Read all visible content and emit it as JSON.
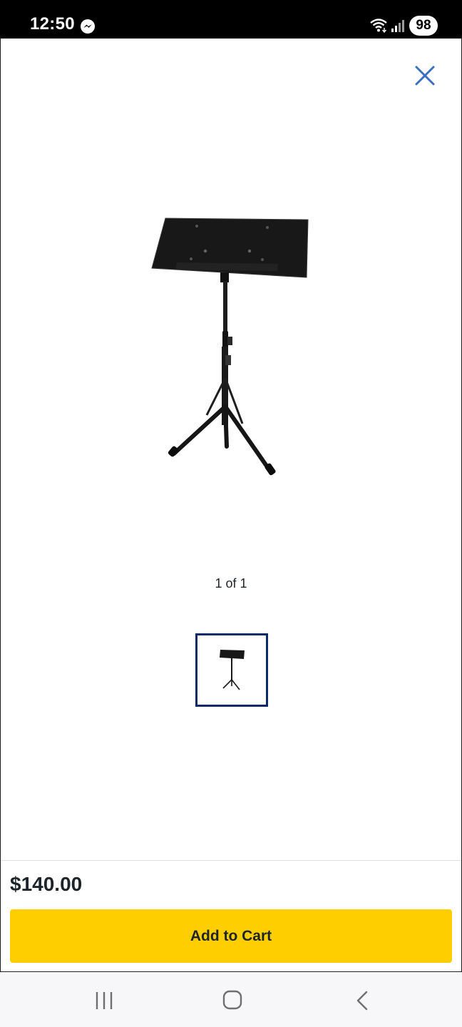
{
  "status_bar": {
    "time": "12:50",
    "battery": "98",
    "icons": [
      "messenger-icon",
      "wifi-icon",
      "signal-icon"
    ]
  },
  "viewer": {
    "close_icon": "close-icon",
    "image_counter": "1 of 1",
    "accent_color": "#3a6fc4",
    "thumbnail_border_color": "#0a2a6b"
  },
  "footer": {
    "price": "$140.00",
    "add_to_cart_label": "Add to Cart",
    "button_color": "#ffce00"
  },
  "nav_bar": {
    "icons": [
      "recent-apps-icon",
      "home-icon",
      "back-icon"
    ]
  }
}
